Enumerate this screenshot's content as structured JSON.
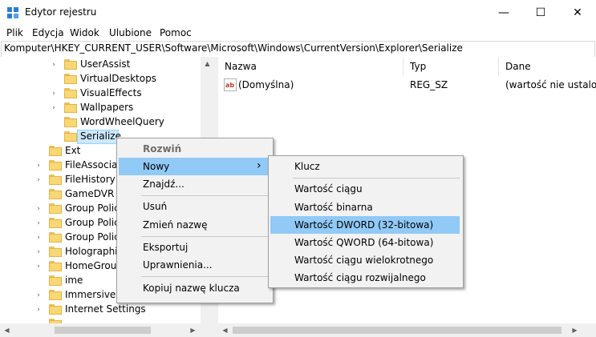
{
  "window": {
    "title": "Edytor rejestru",
    "minimize_glyph": "—",
    "maximize_glyph": "☐",
    "close_glyph": "✕"
  },
  "menu": [
    "Plik",
    "Edycja",
    "Widok",
    "Ulubione",
    "Pomoc"
  ],
  "address": "Komputer\\HKEY_CURRENT_USER\\Software\\Microsoft\\Windows\\CurrentVersion\\Explorer\\Serialize",
  "tree": {
    "children": [
      "UserAssist",
      "VirtualDesktops",
      "VisualEffects",
      "Wallpapers",
      "WordWheelQuery",
      "Serialize"
    ],
    "selected": "Serialize",
    "siblings": [
      "Ext",
      "FileAssociat",
      "FileHistory",
      "GameDVR",
      "Group Polic",
      "Group Polic",
      "Group Polic",
      "Holographi",
      "HomeGroup",
      "ime",
      "ImmersiveS",
      "Internet Settings"
    ]
  },
  "list": {
    "columns": [
      "Nazwa",
      "Typ",
      "Dane"
    ],
    "rows": [
      {
        "name": "(Domyślna)",
        "type": "REG_SZ",
        "data": "(wartość nie ustalona)"
      }
    ]
  },
  "context_menu": {
    "items": [
      "Rozwiń",
      "Nowy",
      "Znajdź...",
      "Usuń",
      "Zmień nazwę",
      "Eksportuj",
      "Uprawnienia...",
      "Kopiuj nazwę klucza"
    ],
    "highlighted": "Nowy",
    "submenu_arrow": "›"
  },
  "submenu": {
    "items": [
      "Klucz",
      "Wartość ciągu",
      "Wartość binarna",
      "Wartość DWORD (32-bitowa)",
      "Wartość QWORD (64-bitowa)",
      "Wartość ciągu wielokrotnego",
      "Wartość ciągu rozwijalnego"
    ],
    "highlighted": "Wartość DWORD (32-bitowa)"
  },
  "colors": {
    "highlight": "#91c9f7",
    "selection": "#cce8ff",
    "folder": "#f8d775",
    "menu_bg": "#f2f2f2"
  }
}
